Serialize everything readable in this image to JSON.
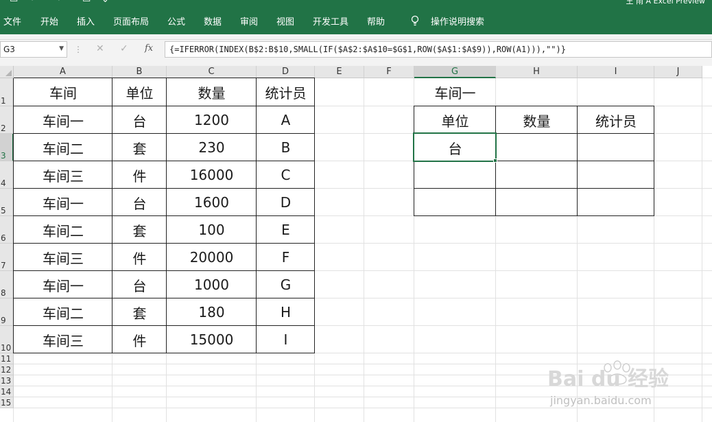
{
  "titlebar": {
    "right_text": "王 雨 A    Excel Preview"
  },
  "menu_tabs": [
    "文件",
    "开始",
    "插入",
    "页面布局",
    "公式",
    "数据",
    "审阅",
    "视图",
    "开发工具",
    "帮助"
  ],
  "tell_me": "操作说明搜索",
  "formula_bar": {
    "name_box": "G3",
    "fx": "fx",
    "cancel": "✕",
    "enter": "✓",
    "formula": "{=IFERROR(INDEX(B$2:B$10,SMALL(IF($A$2:$A$10=$G$1,ROW($A$1:$A$9)),ROW(A1))),\"\")}"
  },
  "columns": [
    "A",
    "B",
    "C",
    "D",
    "E",
    "F",
    "G",
    "H",
    "I",
    "J"
  ],
  "rows": [
    "1",
    "2",
    "3",
    "4",
    "5",
    "6",
    "7",
    "8",
    "9",
    "10",
    "11",
    "12",
    "13",
    "14",
    "15"
  ],
  "selected": {
    "column": "G",
    "row": "3"
  },
  "source_table": {
    "headers": [
      "车间",
      "单位",
      "数量",
      "统计员"
    ],
    "rows": [
      [
        "车间一",
        "台",
        "1200",
        "A"
      ],
      [
        "车间二",
        "套",
        "230",
        "B"
      ],
      [
        "车间三",
        "件",
        "16000",
        "C"
      ],
      [
        "车间一",
        "台",
        "1600",
        "D"
      ],
      [
        "车间二",
        "套",
        "100",
        "E"
      ],
      [
        "车间三",
        "件",
        "20000",
        "F"
      ],
      [
        "车间一",
        "台",
        "1000",
        "G"
      ],
      [
        "车间二",
        "套",
        "180",
        "H"
      ],
      [
        "车间三",
        "件",
        "15000",
        "I"
      ]
    ]
  },
  "lookup": {
    "key": "车间一",
    "headers": [
      "单位",
      "数量",
      "统计员"
    ],
    "rows": [
      [
        "台",
        "",
        ""
      ],
      [
        "",
        "",
        ""
      ],
      [
        "",
        "",
        ""
      ]
    ]
  },
  "watermark": {
    "brand": "Bai du 经验",
    "url": "jingyan.baidu.com"
  },
  "colors": {
    "excel_green": "#217346",
    "header_gray": "#e6e6e6",
    "gridline": "#e1e1e1"
  }
}
